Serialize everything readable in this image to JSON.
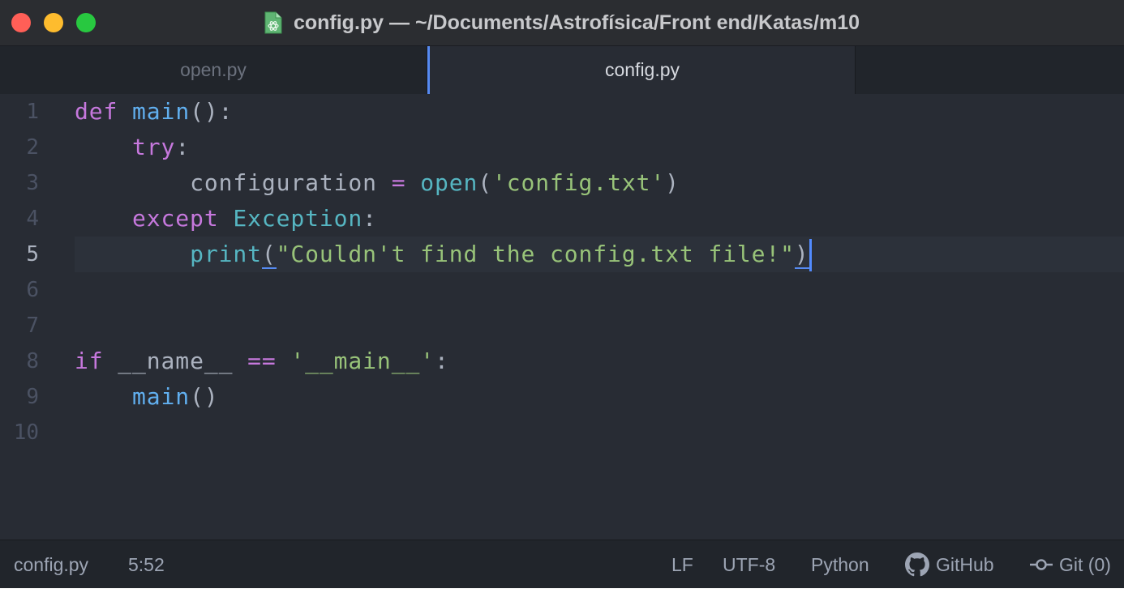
{
  "window": {
    "title": "config.py — ~/Documents/Astrofísica/Front end/Katas/m10"
  },
  "tabs": [
    {
      "label": "open.py",
      "active": false
    },
    {
      "label": "config.py",
      "active": true
    }
  ],
  "editor": {
    "line_numbers": [
      "1",
      "2",
      "3",
      "4",
      "5",
      "6",
      "7",
      "8",
      "9",
      "10"
    ],
    "current_line": 5,
    "code": {
      "l1": {
        "kw": "def",
        "fn": "main",
        "rest": "():"
      },
      "l2": {
        "indent": "    ",
        "kw": "try",
        "rest": ":"
      },
      "l3": {
        "indent": "        ",
        "var": "configuration",
        "op": "=",
        "bi": "open",
        "open_paren": "(",
        "str": "'config.txt'",
        "close_paren": ")"
      },
      "l4": {
        "indent": "    ",
        "kw": "except",
        "cls": "Exception",
        "rest": ":"
      },
      "l5": {
        "indent": "        ",
        "bi": "print",
        "open_paren": "(",
        "str": "\"Couldn't find the config.txt file!\"",
        "close_paren": ")"
      },
      "l8": {
        "kw": "if",
        "var": "__name__",
        "op": "==",
        "str": "'__main__'",
        "rest": ":"
      },
      "l9": {
        "indent": "    ",
        "fn": "main",
        "rest": "()"
      }
    }
  },
  "statusbar": {
    "file": "config.py",
    "cursor": "5:52",
    "line_ending": "LF",
    "encoding": "UTF-8",
    "grammar": "Python",
    "github": "GitHub",
    "git": "Git (0)"
  },
  "colors": {
    "keyword": "#c678dd",
    "function": "#61afef",
    "builtin": "#56b6c2",
    "string": "#98c379",
    "background": "#282c34",
    "accent": "#568af2"
  }
}
